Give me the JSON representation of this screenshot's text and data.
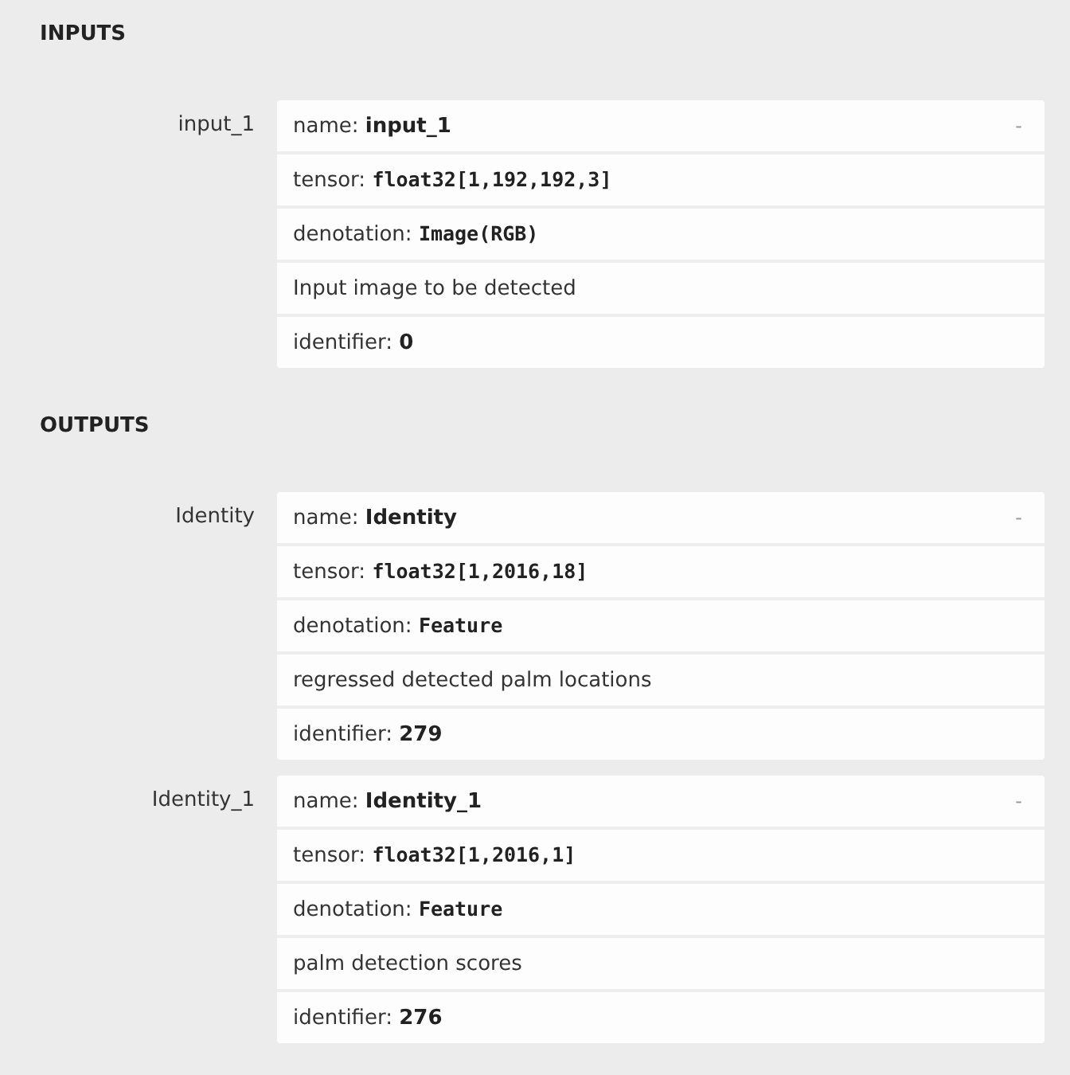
{
  "sections": [
    {
      "title": "INPUTS",
      "arguments": [
        {
          "label": "input_1",
          "toggle": "-",
          "rows": [
            {
              "kind": "field",
              "label": "name:",
              "value": "input_1"
            },
            {
              "kind": "code",
              "label": "tensor:",
              "value": "float32[1,192,192,3]"
            },
            {
              "kind": "code",
              "label": "denotation:",
              "value": "Image(RGB)"
            },
            {
              "kind": "text",
              "text": "Input image to be detected"
            },
            {
              "kind": "field",
              "label": "identifier:",
              "value": "0"
            }
          ]
        }
      ]
    },
    {
      "title": "OUTPUTS",
      "arguments": [
        {
          "label": "Identity",
          "toggle": "-",
          "rows": [
            {
              "kind": "field",
              "label": "name:",
              "value": "Identity"
            },
            {
              "kind": "code",
              "label": "tensor:",
              "value": "float32[1,2016,18]"
            },
            {
              "kind": "code",
              "label": "denotation:",
              "value": "Feature"
            },
            {
              "kind": "text",
              "text": "regressed detected palm locations"
            },
            {
              "kind": "field",
              "label": "identifier:",
              "value": "279"
            }
          ]
        },
        {
          "label": "Identity_1",
          "toggle": "-",
          "rows": [
            {
              "kind": "field",
              "label": "name:",
              "value": "Identity_1"
            },
            {
              "kind": "code",
              "label": "tensor:",
              "value": "float32[1,2016,1]"
            },
            {
              "kind": "code",
              "label": "denotation:",
              "value": "Feature"
            },
            {
              "kind": "text",
              "text": "palm detection scores"
            },
            {
              "kind": "field",
              "label": "identifier:",
              "value": "276"
            }
          ]
        }
      ]
    }
  ]
}
